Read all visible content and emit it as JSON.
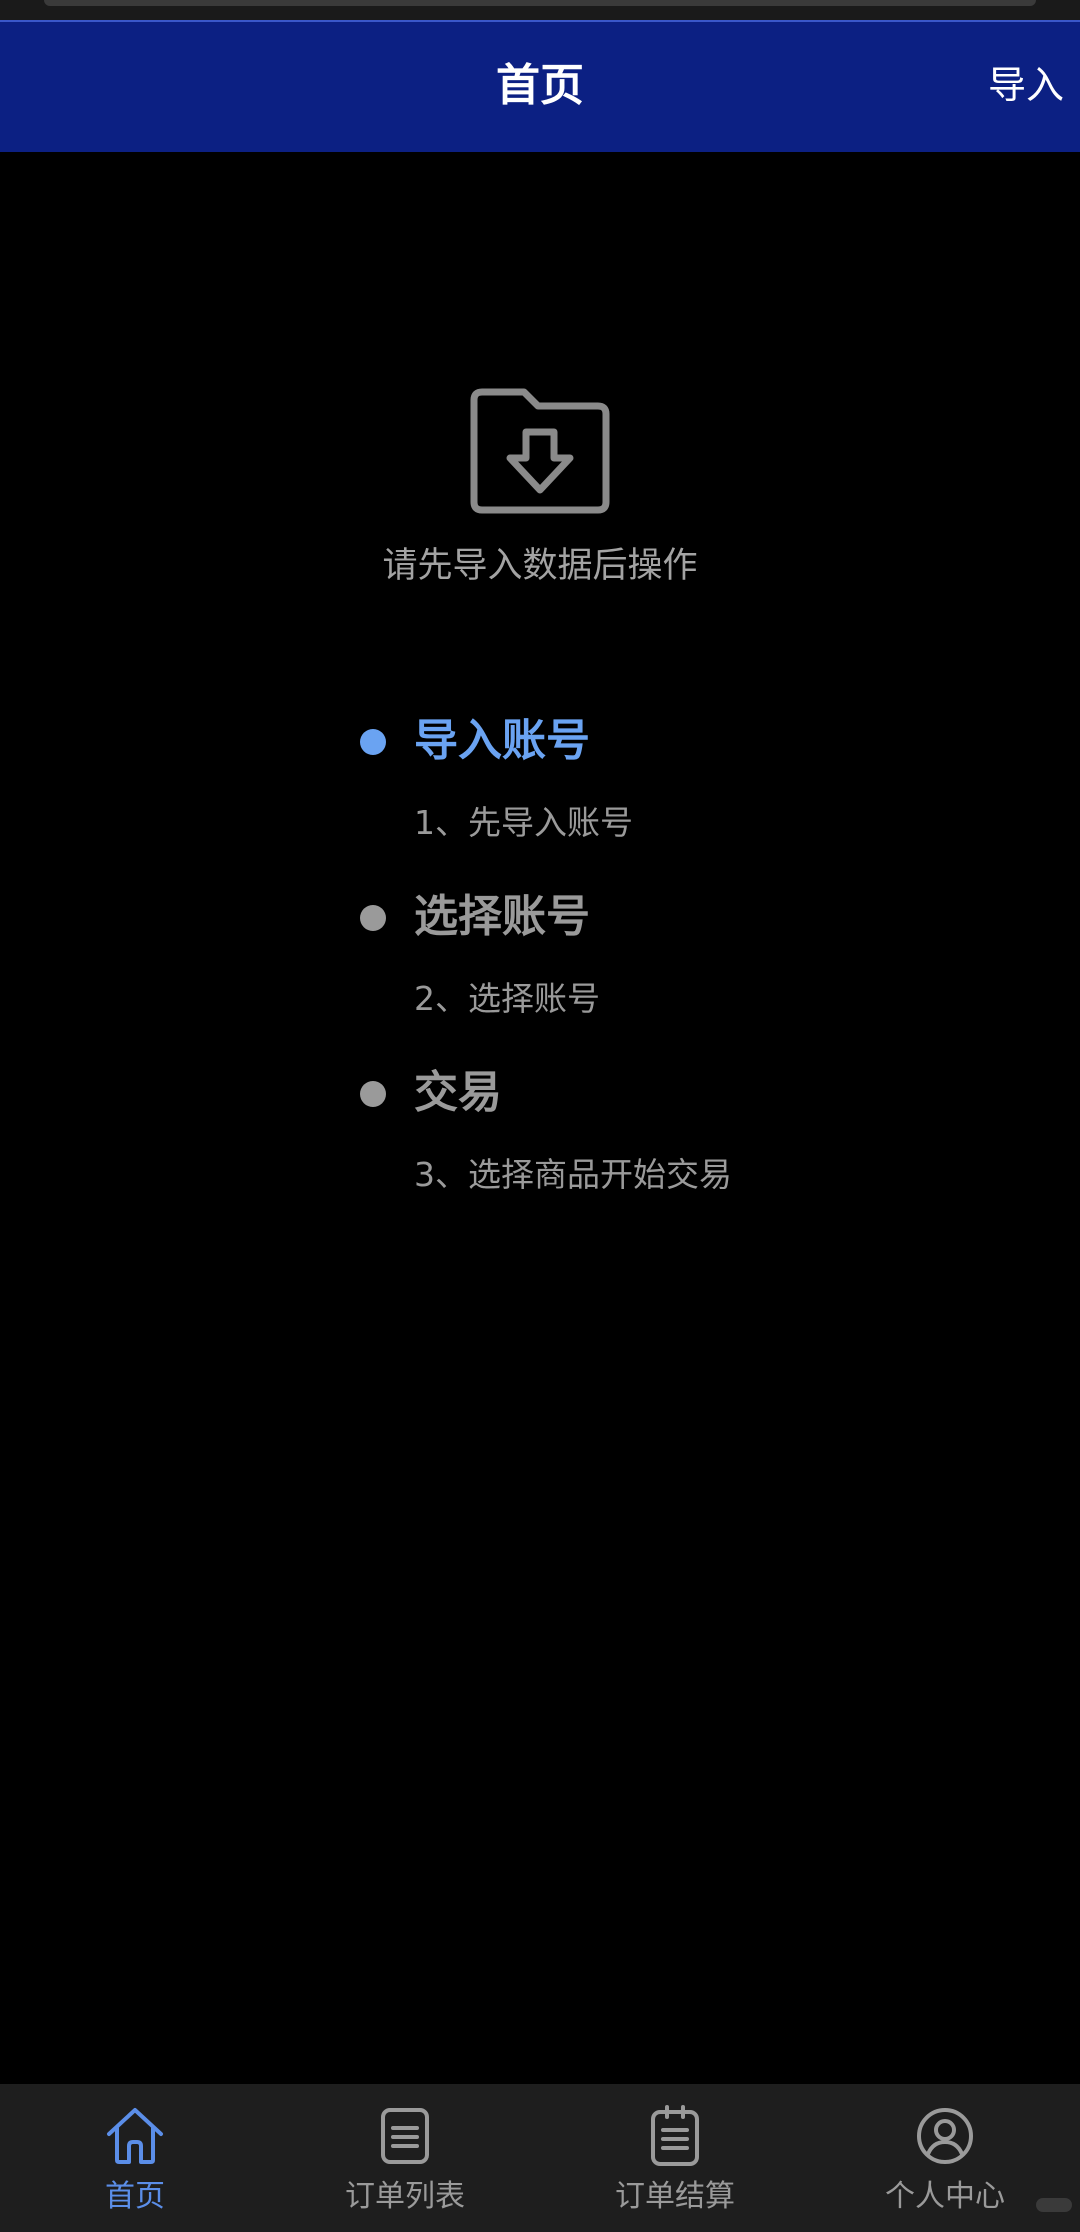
{
  "header": {
    "title": "首页",
    "action_label": "导入"
  },
  "empty_state": {
    "icon": "folder-download-icon",
    "message": "请先导入数据后操作"
  },
  "steps": [
    {
      "title": "导入账号",
      "desc": "1、先导入账号",
      "active": true
    },
    {
      "title": "选择账号",
      "desc": "2、选择账号",
      "active": false
    },
    {
      "title": "交易",
      "desc": "3、选择商品开始交易",
      "active": false
    }
  ],
  "tabbar": {
    "items": [
      {
        "label": "首页",
        "icon": "home-icon",
        "active": true
      },
      {
        "label": "订单列表",
        "icon": "list-icon",
        "active": false
      },
      {
        "label": "订单结算",
        "icon": "clipboard-icon",
        "active": false
      },
      {
        "label": "个人中心",
        "icon": "user-icon",
        "active": false
      }
    ]
  },
  "colors": {
    "header_bg": "#0c2083",
    "accent": "#6aa3f2",
    "inactive": "#9a9a9a",
    "tabbar_bg": "#1e1e1e"
  }
}
